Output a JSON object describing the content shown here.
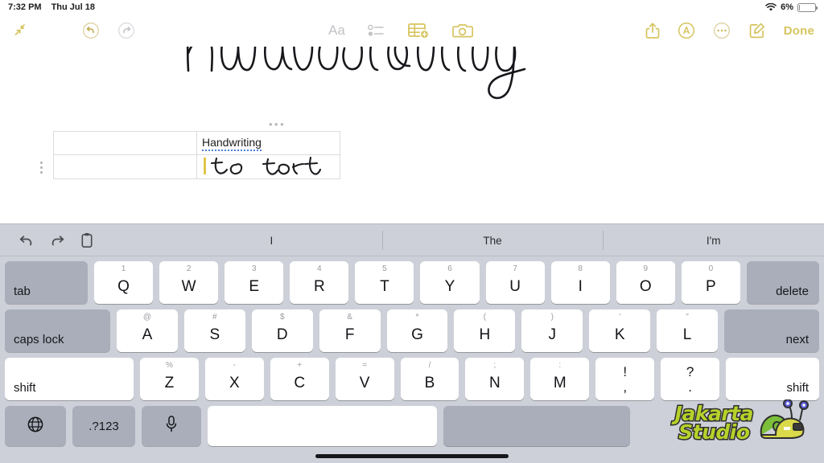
{
  "status_bar": {
    "time": "7:32 PM",
    "date": "Thu Jul 18",
    "wifi_icon": "wifi-icon",
    "battery_percent": "6%",
    "battery_level": 6
  },
  "toolbar": {
    "left": [
      {
        "name": "collapse-icon",
        "label": ""
      },
      {
        "name": "undo-icon",
        "label": ""
      },
      {
        "name": "redo-icon",
        "label": ""
      }
    ],
    "center": [
      {
        "name": "format-text-icon",
        "label": "Aa",
        "state": "inactive"
      },
      {
        "name": "checklist-icon",
        "label": "",
        "state": "inactive"
      },
      {
        "name": "table-icon",
        "label": "",
        "state": "active"
      },
      {
        "name": "camera-icon",
        "label": "",
        "state": "active"
      }
    ],
    "right": [
      {
        "name": "share-icon",
        "label": ""
      },
      {
        "name": "markup-icon",
        "label": ""
      },
      {
        "name": "more-options-icon",
        "label": ""
      },
      {
        "name": "compose-icon",
        "label": ""
      }
    ],
    "done_label": "Done",
    "accent_color": "#d6c45f",
    "inactive_color": "#c2c2c6"
  },
  "note": {
    "title_handwritten": "Handwriting",
    "table": {
      "menu_dots": "•••",
      "rows": [
        {
          "cells": [
            {
              "text": "",
              "type": "empty"
            },
            {
              "text": "Handwriting",
              "type": "converted-text",
              "underline": "spell-dotted"
            }
          ]
        },
        {
          "cells": [
            {
              "text": "",
              "type": "empty"
            },
            {
              "text": "to text",
              "type": "handwritten-ink"
            }
          ]
        }
      ],
      "caret_color": "#e0c64a"
    }
  },
  "keyboard": {
    "predictive": {
      "tools": [
        {
          "name": "undo-icon"
        },
        {
          "name": "redo-icon"
        },
        {
          "name": "paste-icon"
        }
      ],
      "suggestions": [
        "I",
        "The",
        "I'm"
      ]
    },
    "rows": [
      {
        "name": "number-letter-row",
        "keys": [
          {
            "name": "tab",
            "label": "tab",
            "style": "mod-left"
          },
          {
            "name": "q",
            "label": "Q",
            "alt": "1"
          },
          {
            "name": "w",
            "label": "W",
            "alt": "2"
          },
          {
            "name": "e",
            "label": "E",
            "alt": "3"
          },
          {
            "name": "r",
            "label": "R",
            "alt": "4"
          },
          {
            "name": "t",
            "label": "T",
            "alt": "5"
          },
          {
            "name": "y",
            "label": "Y",
            "alt": "6"
          },
          {
            "name": "u",
            "label": "U",
            "alt": "7"
          },
          {
            "name": "i",
            "label": "I",
            "alt": "8"
          },
          {
            "name": "o",
            "label": "O",
            "alt": "9"
          },
          {
            "name": "p",
            "label": "P",
            "alt": "0"
          },
          {
            "name": "delete",
            "label": "delete",
            "style": "mod-right"
          }
        ]
      },
      {
        "name": "home-row",
        "keys": [
          {
            "name": "caps-lock",
            "label": "caps lock",
            "style": "mod-left"
          },
          {
            "name": "a",
            "label": "A",
            "alt": "@"
          },
          {
            "name": "s",
            "label": "S",
            "alt": "#"
          },
          {
            "name": "d",
            "label": "D",
            "alt": "$"
          },
          {
            "name": "f",
            "label": "F",
            "alt": "&"
          },
          {
            "name": "g",
            "label": "G",
            "alt": "*"
          },
          {
            "name": "h",
            "label": "H",
            "alt": "("
          },
          {
            "name": "j",
            "label": "J",
            "alt": ")"
          },
          {
            "name": "k",
            "label": "K",
            "alt": "'"
          },
          {
            "name": "l",
            "label": "L",
            "alt": "\""
          },
          {
            "name": "next",
            "label": "next",
            "style": "mod-right"
          }
        ]
      },
      {
        "name": "shift-row",
        "keys": [
          {
            "name": "shift-left",
            "label": "shift",
            "style": "mod-light-left"
          },
          {
            "name": "z",
            "label": "Z",
            "alt": "%"
          },
          {
            "name": "x",
            "label": "X",
            "alt": "-"
          },
          {
            "name": "c",
            "label": "C",
            "alt": "+"
          },
          {
            "name": "v",
            "label": "V",
            "alt": "="
          },
          {
            "name": "b",
            "label": "B",
            "alt": "/"
          },
          {
            "name": "n",
            "label": "N",
            "alt": ";"
          },
          {
            "name": "m",
            "label": "M",
            "alt": ":"
          },
          {
            "name": "exclam-comma",
            "label": ",",
            "alt": "!",
            "dual": true
          },
          {
            "name": "question-period",
            "label": ".",
            "alt": "?",
            "dual": true
          },
          {
            "name": "shift-right",
            "label": "shift",
            "style": "mod-light-right"
          }
        ]
      },
      {
        "name": "bottom-row",
        "keys": [
          {
            "name": "globe-icon",
            "label": "",
            "style": "mod-icon"
          },
          {
            "name": "numbers",
            "label": ".?123",
            "style": "mod"
          },
          {
            "name": "dictation-icon",
            "label": "",
            "style": "mod-icon"
          },
          {
            "name": "space",
            "label": "",
            "style": "space"
          },
          {
            "name": "hide-keyboard",
            "label": "",
            "style": "mod-hide"
          }
        ]
      }
    ]
  },
  "watermark": {
    "line1": "Jakarta",
    "line2": "Studio",
    "mascot": "snail-with-camera-icon",
    "text_color": "#b6d12a",
    "outline_color": "#2f2f2f"
  }
}
